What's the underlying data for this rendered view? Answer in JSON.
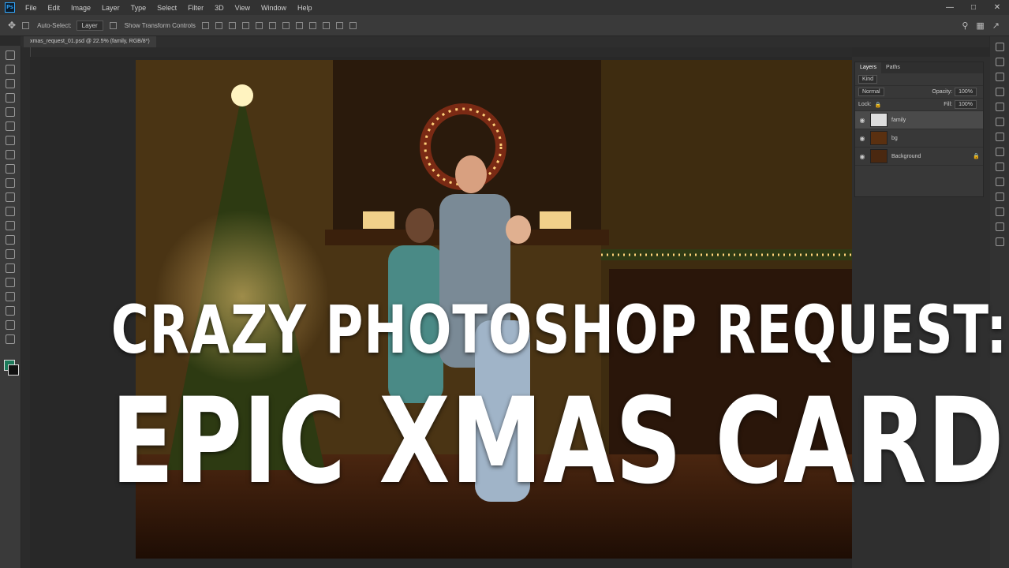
{
  "app": {
    "logo_text": "Ps",
    "menu": [
      "File",
      "Edit",
      "Image",
      "Layer",
      "Type",
      "Select",
      "Filter",
      "3D",
      "View",
      "Window",
      "Help"
    ]
  },
  "options_bar": {
    "auto_select_label": "Auto-Select:",
    "auto_select_value": "Layer",
    "transform_label": "Show Transform Controls"
  },
  "document": {
    "tab_title": "xmas_request_01.psd @ 22.5% (family, RGB/8*)"
  },
  "layers_panel": {
    "tabs": [
      "Layers",
      "Paths"
    ],
    "kind_label": "Kind",
    "blend_mode": "Normal",
    "opacity_label": "Opacity:",
    "opacity_value": "100%",
    "lock_label": "Lock:",
    "fill_label": "Fill:",
    "fill_value": "100%",
    "layers": [
      {
        "name": "family",
        "selected": true,
        "visible": true
      },
      {
        "name": "bg",
        "selected": false,
        "visible": true
      },
      {
        "name": "Background",
        "selected": false,
        "visible": true,
        "locked": true
      }
    ]
  },
  "overlay": {
    "line1": "CRAZY PHOTOSHOP REQUEST:",
    "line2": "EPIC XMAS CARD"
  },
  "colors": {
    "foreground_swatch": "#1c7a5a",
    "background_swatch": "#111111",
    "accent": "#31a8ff"
  }
}
